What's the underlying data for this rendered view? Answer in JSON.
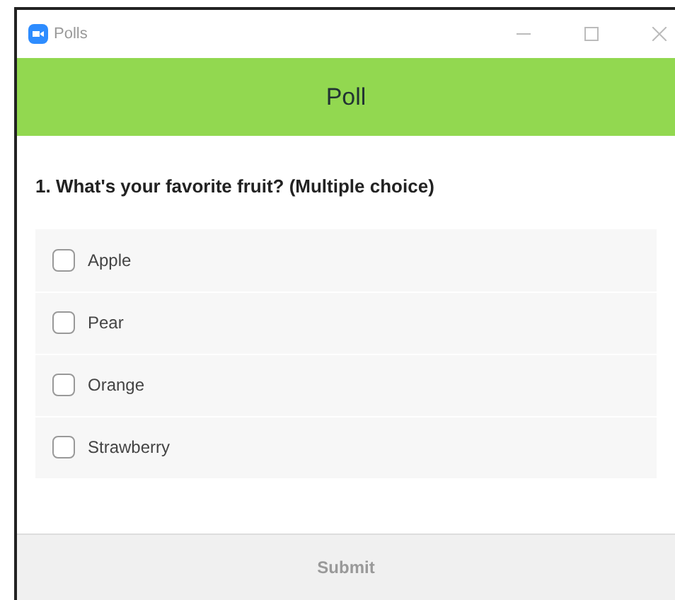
{
  "window": {
    "title": "Polls"
  },
  "header": {
    "title": "Poll"
  },
  "question": "1. What's your favorite fruit? (Multiple choice)",
  "options": [
    {
      "label": "Apple",
      "checked": false
    },
    {
      "label": "Pear",
      "checked": false
    },
    {
      "label": "Orange",
      "checked": false
    },
    {
      "label": "Strawberry",
      "checked": false
    }
  ],
  "submit": {
    "label": "Submit",
    "disabled": true
  }
}
